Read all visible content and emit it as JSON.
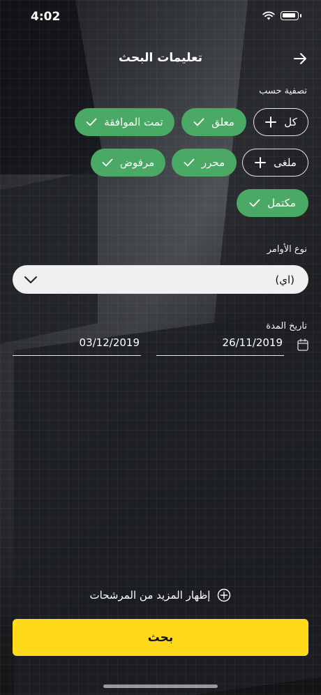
{
  "status_bar": {
    "time": "4:02"
  },
  "header": {
    "title": "تعليمات البحث"
  },
  "filter": {
    "label": "تصفية حسب",
    "chips": [
      {
        "label": "كل",
        "state": "outline",
        "icon": "plus-icon"
      },
      {
        "label": "معلق",
        "state": "selected",
        "icon": "check-icon"
      },
      {
        "label": "تمت الموافقة",
        "state": "selected",
        "icon": "check-icon"
      },
      {
        "label": "ملغى",
        "state": "outline",
        "icon": "plus-icon"
      },
      {
        "label": "محرر",
        "state": "selected",
        "icon": "check-icon"
      },
      {
        "label": "مرفوض",
        "state": "selected",
        "icon": "check-icon"
      },
      {
        "label": "مكتمل",
        "state": "selected",
        "icon": "check-icon"
      }
    ]
  },
  "order_type": {
    "label": "نوع الأوامر",
    "selected": "(اي)"
  },
  "date_range": {
    "label": "تاريخ المدة",
    "from": "26/11/2019",
    "to": "03/12/2019"
  },
  "more_filters": {
    "label": "إظهار المزيد من المرشحات"
  },
  "search_button": {
    "label": "بحث"
  },
  "colors": {
    "accent_yellow": "#ffda1a",
    "chip_green": "#4aa964",
    "select_bg": "#f0f0f0"
  }
}
